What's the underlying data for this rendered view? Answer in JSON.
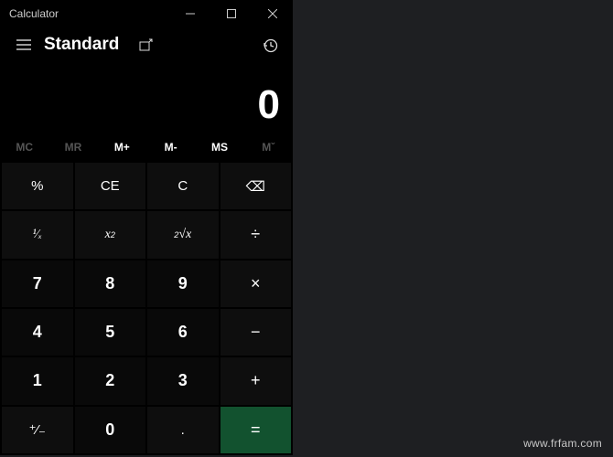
{
  "window": {
    "title": "Calculator",
    "minimize": "–",
    "maximize": "◻",
    "close": "✕"
  },
  "header": {
    "mode": "Standard"
  },
  "display": {
    "value": "0"
  },
  "memory": {
    "mc": "MC",
    "mr": "MR",
    "mplus": "M+",
    "mminus": "M-",
    "ms": "MS",
    "mlist": "Mˇ"
  },
  "keys": {
    "percent": "%",
    "ce": "CE",
    "c": "C",
    "backspace": "⌫",
    "reciprocal": "¹⁄ₓ",
    "square": "x²",
    "sqrt": "²√x",
    "divide": "÷",
    "n7": "7",
    "n8": "8",
    "n9": "9",
    "multiply": "×",
    "n4": "4",
    "n5": "5",
    "n6": "6",
    "minus": "−",
    "n1": "1",
    "n2": "2",
    "n3": "3",
    "plus": "+",
    "negate": "⁺⁄₋",
    "n0": "0",
    "decimal": ".",
    "equals": "="
  },
  "watermark": "www.frfam.com"
}
